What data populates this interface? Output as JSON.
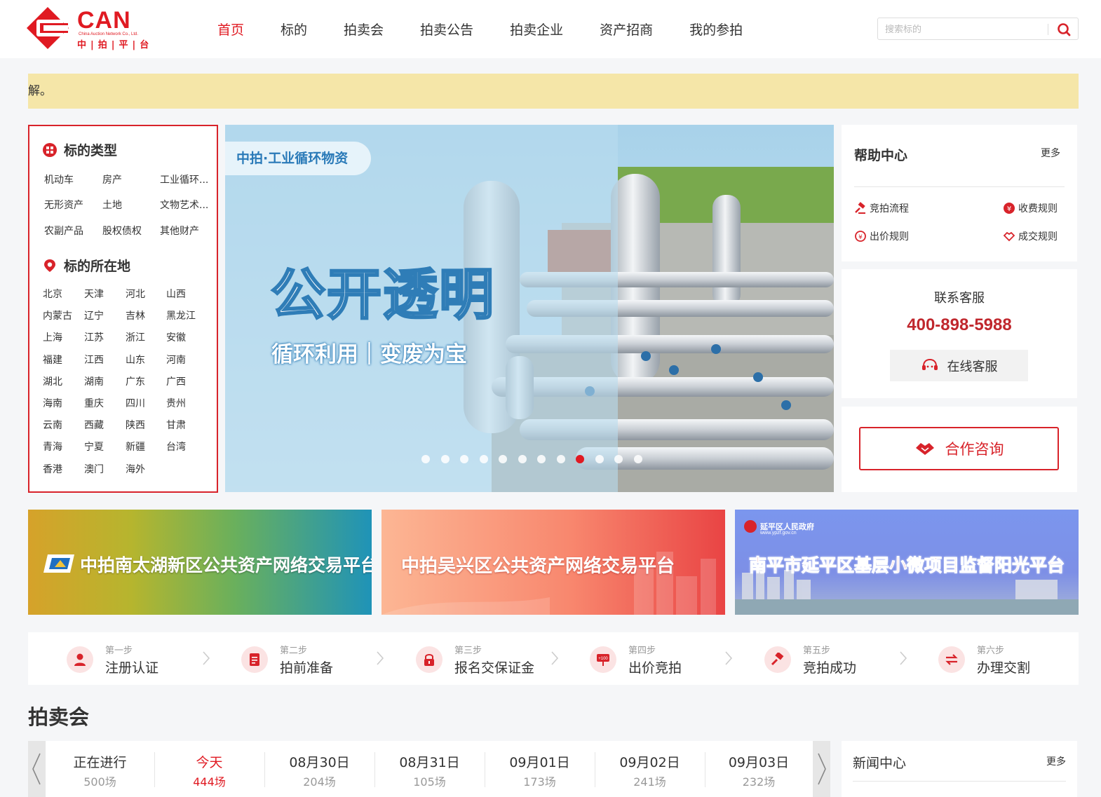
{
  "brand": {
    "logo_text": "CAN",
    "logo_en": "China Auction Network Co., Ltd.",
    "logo_cn": "中|拍|平|台",
    "accent_color": "#e01a22"
  },
  "nav": {
    "items": [
      {
        "label": "首页",
        "active": true
      },
      {
        "label": "标的",
        "active": false
      },
      {
        "label": "拍卖会",
        "active": false
      },
      {
        "label": "拍卖公告",
        "active": false
      },
      {
        "label": "拍卖企业",
        "active": false
      },
      {
        "label": "资产招商",
        "active": false
      },
      {
        "label": "我的参拍",
        "active": false
      }
    ]
  },
  "search": {
    "placeholder": "搜索标的",
    "value": "",
    "icon": "search-icon"
  },
  "notice": {
    "text": "了解。"
  },
  "categories": {
    "title": "标的类型",
    "icon": "grid-icon",
    "items": [
      "机动车",
      "房产",
      "工业循环...",
      "无形资产",
      "土地",
      "文物艺术...",
      "农副产品",
      "股权债权",
      "其他财产"
    ]
  },
  "locations": {
    "title": "标的所在地",
    "icon": "location-pin-icon",
    "items": [
      "北京",
      "天津",
      "河北",
      "山西",
      "内蒙古",
      "辽宁",
      "吉林",
      "黑龙江",
      "上海",
      "江苏",
      "浙江",
      "安徽",
      "福建",
      "江西",
      "山东",
      "河南",
      "湖北",
      "湖南",
      "广东",
      "广西",
      "海南",
      "重庆",
      "四川",
      "贵州",
      "云南",
      "西藏",
      "陕西",
      "甘肃",
      "青海",
      "宁夏",
      "新疆",
      "台湾",
      "香港",
      "澳门",
      "海外"
    ]
  },
  "banner": {
    "tag": "中拍·工业循环物资",
    "headline": "公开透明",
    "subline": "循环利用｜变废为宝",
    "dot_count": 12,
    "active_dot": 9
  },
  "help_center": {
    "title": "帮助中心",
    "more": "更多",
    "items": [
      {
        "label": "竞拍流程",
        "icon": "gavel-icon"
      },
      {
        "label": "收费规则",
        "icon": "yuan-coin-icon"
      },
      {
        "label": "出价规则",
        "icon": "bid-rule-icon"
      },
      {
        "label": "成交规则",
        "icon": "handshake-icon"
      }
    ]
  },
  "contact": {
    "title": "联系客服",
    "phone": "400-898-5988",
    "online_label": "在线客服",
    "online_icon": "chat-headset-icon"
  },
  "cooperation": {
    "label": "合作咨询",
    "icon": "handshake-icon"
  },
  "platforms": [
    {
      "label": "中拍南太湖新区公共资产网络交易平台"
    },
    {
      "label": "中拍吴兴区公共资产网络交易平台"
    },
    {
      "label": "南平市延平区基层小微项目监督阳光平台",
      "gov_label": "延平区人民政府",
      "gov_url": "www.ypzf.gov.cn"
    }
  ],
  "steps": [
    {
      "step": "第一步",
      "label": "注册认证",
      "icon": "user-verify-icon"
    },
    {
      "step": "第二步",
      "label": "拍前准备",
      "icon": "document-icon"
    },
    {
      "step": "第三步",
      "label": "报名交保证金",
      "icon": "lock-icon"
    },
    {
      "step": "第四步",
      "label": "出价竞拍",
      "icon": "bid-paddle-icon",
      "paddle_text": "+100"
    },
    {
      "step": "第五步",
      "label": "竞拍成功",
      "icon": "gavel-icon"
    },
    {
      "step": "第六步",
      "label": "办理交割",
      "icon": "transfer-icon"
    }
  ],
  "auction": {
    "title": "拍卖会",
    "days": [
      {
        "date": "正在进行",
        "count": "500场",
        "today": false
      },
      {
        "date": "今天",
        "count": "444场",
        "today": true
      },
      {
        "date": "08月30日",
        "count": "204场",
        "today": false
      },
      {
        "date": "08月31日",
        "count": "105场",
        "today": false
      },
      {
        "date": "09月01日",
        "count": "173场",
        "today": false
      },
      {
        "date": "09月02日",
        "count": "241场",
        "today": false
      },
      {
        "date": "09月03日",
        "count": "232场",
        "today": false
      }
    ]
  },
  "news": {
    "title": "新闻中心",
    "more": "更多"
  }
}
